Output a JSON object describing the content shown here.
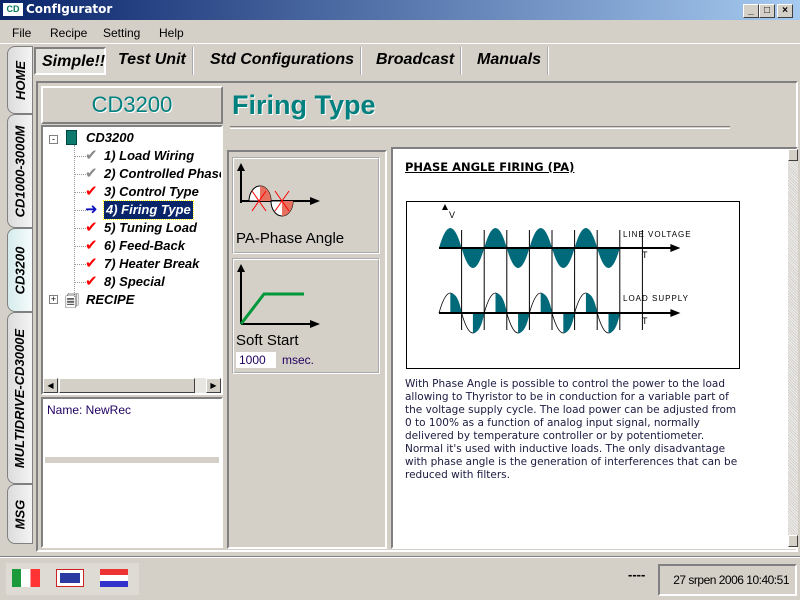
{
  "window": {
    "title": "ConfIgurator",
    "logo": "CD",
    "buttons": [
      "minimize",
      "maximize",
      "close"
    ]
  },
  "menu": [
    "File",
    "Recipe",
    "Setting",
    "Help"
  ],
  "side_tabs": [
    {
      "label": "HOME"
    },
    {
      "label": "CD1000-3000M"
    },
    {
      "label": "CD3200",
      "active": true
    },
    {
      "label": "MULTIDRIVE-CD3000E"
    },
    {
      "label": "MSG"
    }
  ],
  "top_tabs": [
    {
      "label": "Simple!!",
      "active": true
    },
    {
      "label": "Test Unit"
    },
    {
      "label": "Std Configurations"
    },
    {
      "label": "Broadcast"
    },
    {
      "label": "Manuals"
    }
  ],
  "device": {
    "title": "CD3200"
  },
  "tree": {
    "root": "CD3200",
    "items": [
      {
        "label": "1) Load Wiring",
        "status": "grey-check"
      },
      {
        "label": "2) Controlled Phase",
        "status": "grey-check"
      },
      {
        "label": "3) Control Type",
        "status": "red-check"
      },
      {
        "label": "4) Firing Type",
        "status": "arrow",
        "selected": true
      },
      {
        "label": "5) Tuning Load",
        "status": "red-check"
      },
      {
        "label": "6) Feed-Back",
        "status": "red-check"
      },
      {
        "label": "7) Heater Break",
        "status": "red-check"
      },
      {
        "label": "8) Special",
        "status": "red-check"
      }
    ],
    "recipe": "RECIPE"
  },
  "recipe_name": "Name: NewRec",
  "page": {
    "title": "Firing Type"
  },
  "options": {
    "phase_angle": {
      "label": "PA-Phase Angle"
    },
    "soft_start": {
      "label": "Soft Start",
      "value": "1000",
      "unit": "msec."
    }
  },
  "content": {
    "heading": "PHASE ANGLE FIRING (PA)",
    "diagram": {
      "v_label": "V",
      "line_label": "LINE VOLTAGE",
      "load_label": "LOAD SUPPLY",
      "t_label": "T"
    },
    "body": "With Phase Angle is possible to control the power to the load allowing to Thyristor to be in conduction for a variable part of the voltage supply cycle. The load power can be adjusted from 0 to 100% as a function of analog input signal, normally delivered by temperature controller or by potentiometer. Normal it's used with inductive loads. The only disadvantage with phase angle is the generation of interferences that can be reduced with filters."
  },
  "status": {
    "flags": [
      "italian",
      "english",
      "dutch"
    ],
    "indicator": "----",
    "datetime": "27 srpen 2006 10:40:51"
  },
  "colors": {
    "accent": "#00807f",
    "diagram_fill": "#006a7a",
    "check_red": "#ff0000",
    "titlebar": "#0a246a"
  }
}
